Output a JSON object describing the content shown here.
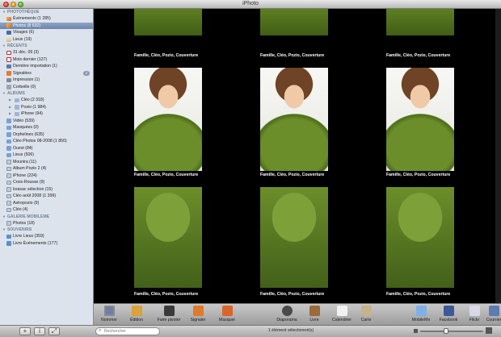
{
  "window": {
    "title": "iPhoto"
  },
  "sidebar": {
    "sections": [
      {
        "key": "library",
        "label": "PHOTOTHÈQUE",
        "items": [
          {
            "label": "Événements (1 285)",
            "icon": "events-icon",
            "selected": false
          },
          {
            "label": "Photos (8 632)",
            "icon": "photos-icon",
            "selected": true
          },
          {
            "label": "Visages (6)",
            "icon": "faces-icon",
            "selected": false
          },
          {
            "label": "Lieux (19)",
            "icon": "places-icon",
            "selected": false
          }
        ]
      },
      {
        "key": "recent",
        "label": "RÉCENTS",
        "items": [
          {
            "label": "31 déc. 09 (3)",
            "icon": "calendar-icon",
            "selected": false
          },
          {
            "label": "Mois dernier (127)",
            "icon": "calendar-icon",
            "selected": false
          },
          {
            "label": "Dernière importation (1)",
            "icon": "import-icon",
            "selected": false
          },
          {
            "label": "Signalées",
            "icon": "flag-icon",
            "selected": false,
            "badge": "0"
          },
          {
            "label": "Impression (1)",
            "icon": "print-icon",
            "selected": false
          },
          {
            "label": "Corbeille (0)",
            "icon": "trash-icon",
            "selected": false
          }
        ]
      },
      {
        "key": "albums",
        "label": "ALBUMS",
        "items": [
          {
            "label": "Cléo (2 318)",
            "icon": "folder-icon",
            "disclosure": true
          },
          {
            "label": "Pozio (1 984)",
            "icon": "folder-icon",
            "disclosure": true
          },
          {
            "label": "iPhone (94)",
            "icon": "folder-icon",
            "disclosure": true
          },
          {
            "label": "Vidéo (539)",
            "icon": "smart-album-icon"
          },
          {
            "label": "Masquées (0)",
            "icon": "smart-album-icon"
          },
          {
            "label": "Orphelines (635)",
            "icon": "smart-album-icon"
          },
          {
            "label": "Cléo Photos 08-2008 (1 850)",
            "icon": "smart-album-icon"
          },
          {
            "label": "Ouest (84)",
            "icon": "smart-album-icon"
          },
          {
            "label": "Lieux (506)",
            "icon": "smart-album-icon"
          },
          {
            "label": "Mounira (11)",
            "icon": "album-icon"
          },
          {
            "label": "Album Pozio 2 (4)",
            "icon": "album-icon"
          },
          {
            "label": "iPhone (224)",
            "icon": "album-icon"
          },
          {
            "label": "Croix-Rousse (9)",
            "icon": "album-icon"
          },
          {
            "label": "koasac sélection (15)",
            "icon": "album-icon"
          },
          {
            "label": "Cléo août 2008 (1 399)",
            "icon": "album-icon"
          },
          {
            "label": "Astropozio (9)",
            "icon": "album-icon"
          },
          {
            "label": "Cléo (4)",
            "icon": "album-icon"
          }
        ]
      },
      {
        "key": "mobileme",
        "label": "GALERIE MOBILEME",
        "items": [
          {
            "label": "Photos (18)",
            "icon": "gallery-icon"
          }
        ]
      },
      {
        "key": "keepsakes",
        "label": "SOUVENIRS",
        "items": [
          {
            "label": "Livre Lieux (359)",
            "icon": "book-icon"
          },
          {
            "label": "Livre Événements (177)",
            "icon": "book-icon"
          }
        ]
      }
    ]
  },
  "photos": {
    "caption": "Famille, Cléo, Pozio, Couverture",
    "rows": 3,
    "columns": 3
  },
  "toolbar": {
    "left": [
      {
        "label": "Nommer",
        "icon": "name-face-icon",
        "active": true
      },
      {
        "label": "Édition",
        "icon": "edit-pencil-icon"
      },
      {
        "label": "Faire pivoter",
        "icon": "rotate-icon"
      },
      {
        "label": "Signaler",
        "icon": "flag-icon"
      },
      {
        "label": "Masquer",
        "icon": "hide-x-icon"
      }
    ],
    "center": [
      {
        "label": "Diaporama",
        "icon": "slideshow-play-icon"
      },
      {
        "label": "Livre",
        "icon": "book-icon"
      },
      {
        "label": "Calendrier",
        "icon": "calendar-icon"
      },
      {
        "label": "Carte",
        "icon": "card-icon"
      }
    ],
    "right": [
      {
        "label": "MobileMe",
        "icon": "mobileme-cloud-icon"
      },
      {
        "label": "Facebook",
        "icon": "facebook-icon"
      },
      {
        "label": "Flickr",
        "icon": "flickr-icon"
      },
      {
        "label": "Courrier",
        "icon": "mail-icon"
      }
    ]
  },
  "statusbar": {
    "search_placeholder": "Rechercher",
    "status": "1 élément sélectionné(s)",
    "zoom_fraction": 0.4
  },
  "colors": {
    "sidebar_bg": "#dde3ec",
    "selection": "#6d85ab",
    "photo_area_bg": "#000000",
    "toolbar_bg": "#b5b5b5"
  }
}
